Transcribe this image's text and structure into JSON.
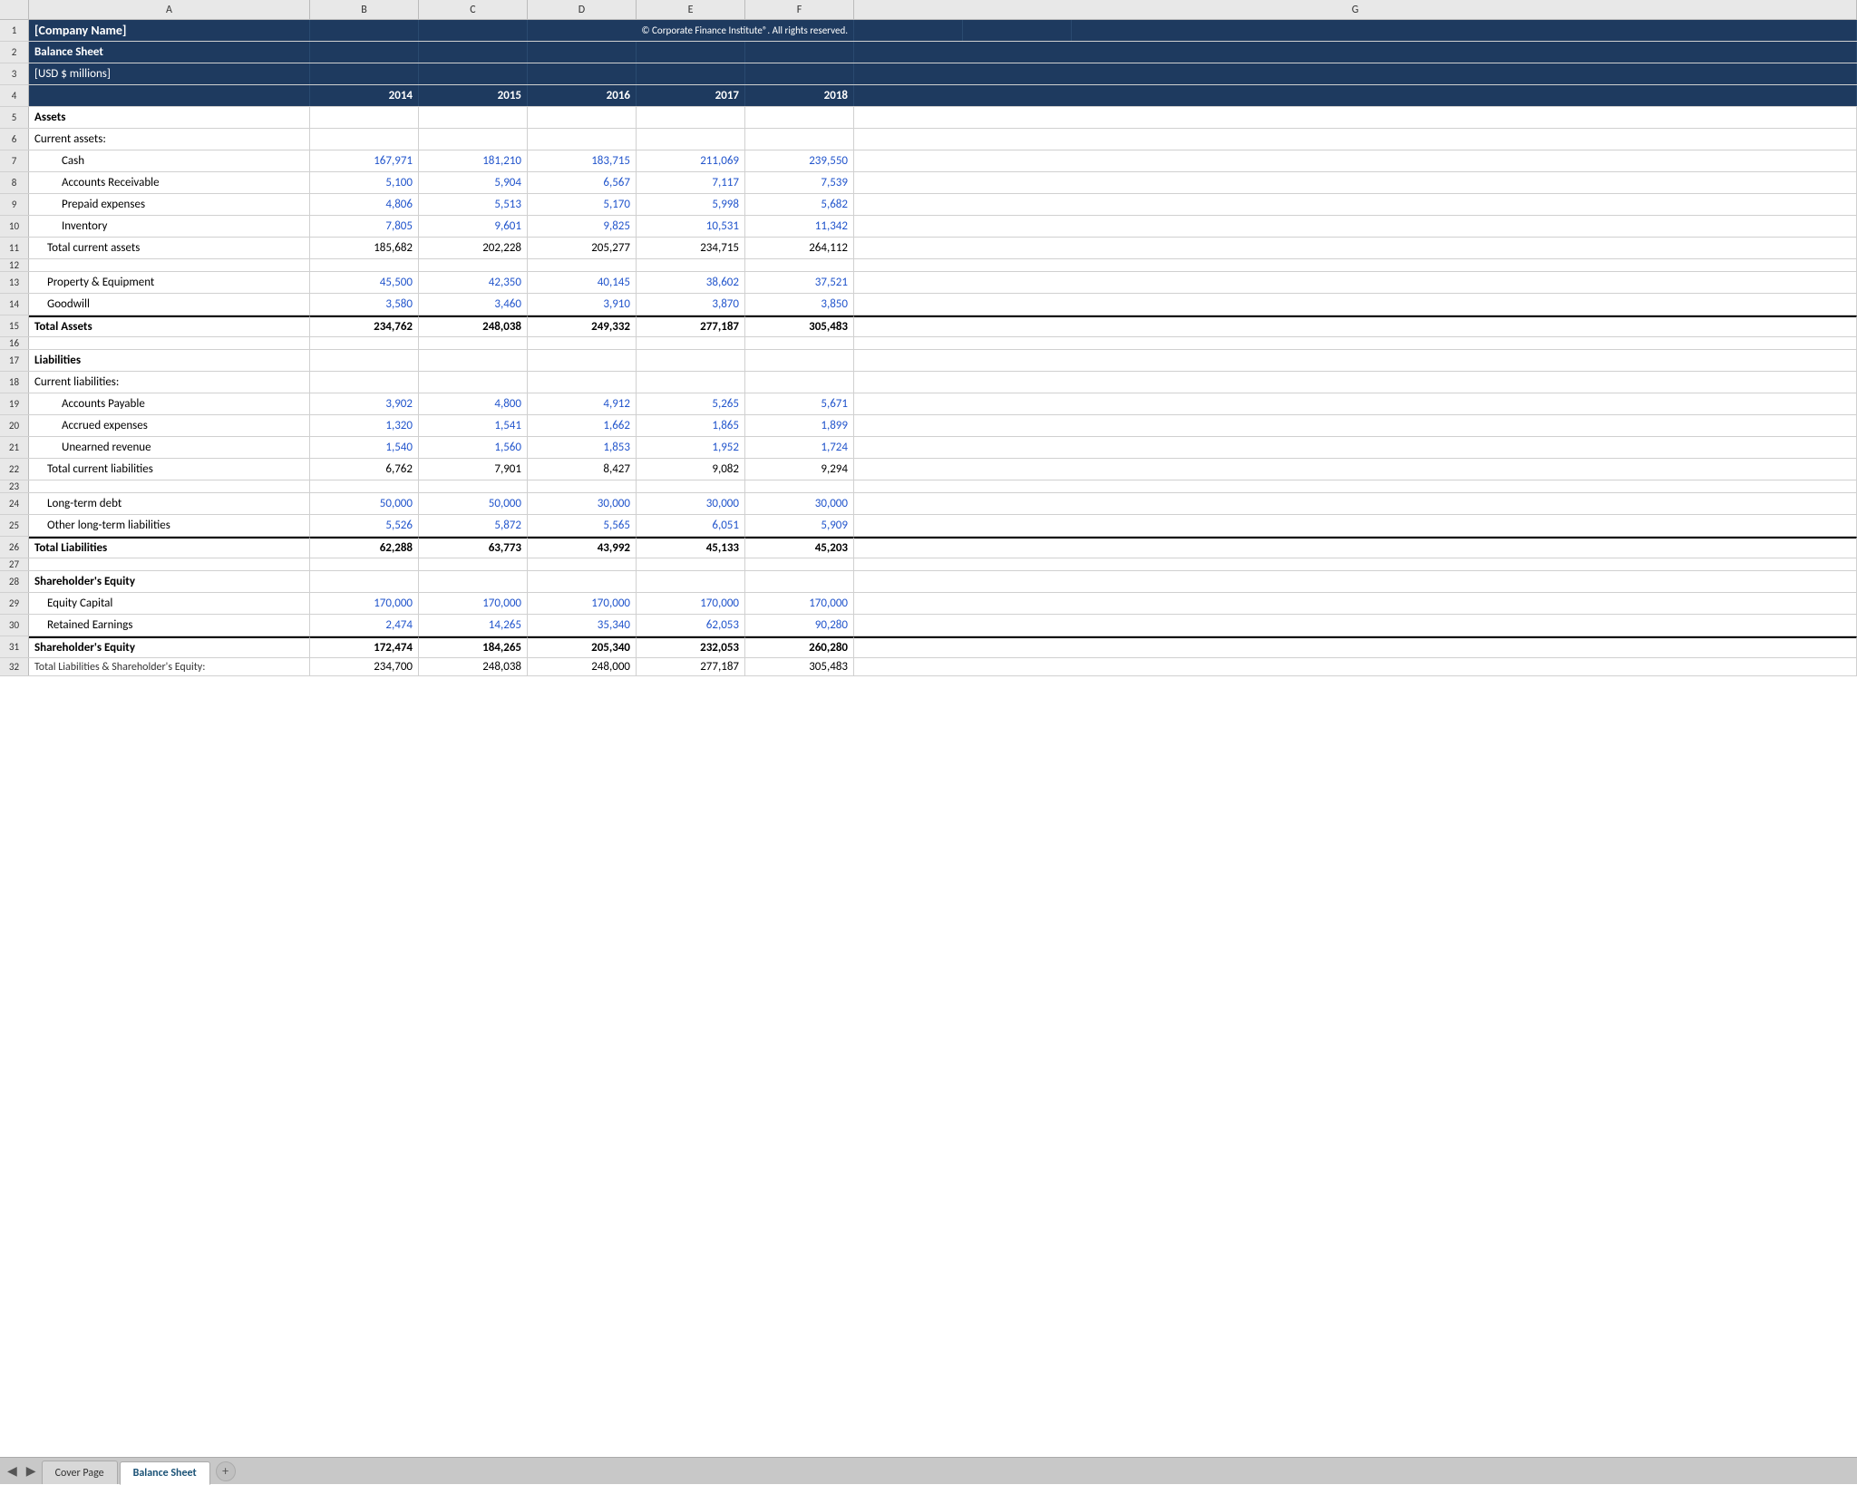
{
  "header": {
    "company_name": "[Company Name]",
    "title": "Balance Sheet",
    "currency": "[USD $ millions]",
    "copyright": "© Corporate Finance Institute®. All rights reserved."
  },
  "columns": {
    "headers": [
      "A",
      "B",
      "C",
      "D",
      "E",
      "F",
      "G"
    ],
    "years": [
      "2014",
      "2015",
      "2016",
      "2017",
      "2018"
    ]
  },
  "rows": [
    {
      "num": "1",
      "type": "dark-title",
      "label": "[Company Name]",
      "copyright": "© Corporate Finance Institute®. All rights reserved."
    },
    {
      "num": "2",
      "type": "dark",
      "label": "Balance Sheet"
    },
    {
      "num": "3",
      "type": "dark",
      "label": "[USD $ millions]"
    },
    {
      "num": "4",
      "type": "year-header",
      "values": [
        "2014",
        "2015",
        "2016",
        "2017",
        "2018"
      ]
    },
    {
      "num": "5",
      "type": "section",
      "label": "Assets"
    },
    {
      "num": "6",
      "type": "normal",
      "label": "Current assets:"
    },
    {
      "num": "7",
      "type": "data-blue",
      "label": "Cash",
      "indent": 2,
      "values": [
        "167,971",
        "181,210",
        "183,715",
        "211,069",
        "239,550"
      ]
    },
    {
      "num": "8",
      "type": "data-blue",
      "label": "Accounts Receivable",
      "indent": 2,
      "values": [
        "5,100",
        "5,904",
        "6,567",
        "7,117",
        "7,539"
      ]
    },
    {
      "num": "9",
      "type": "data-blue",
      "label": "Prepaid expenses",
      "indent": 2,
      "values": [
        "4,806",
        "5,513",
        "5,170",
        "5,998",
        "5,682"
      ]
    },
    {
      "num": "10",
      "type": "data-blue",
      "label": "Inventory",
      "indent": 2,
      "values": [
        "7,805",
        "9,601",
        "9,825",
        "10,531",
        "11,342"
      ]
    },
    {
      "num": "11",
      "type": "subtotal",
      "label": "Total current assets",
      "indent": 1,
      "values": [
        "185,682",
        "202,228",
        "205,277",
        "234,715",
        "264,112"
      ]
    },
    {
      "num": "12",
      "type": "spacer"
    },
    {
      "num": "13",
      "type": "data-blue",
      "label": "Property & Equipment",
      "indent": 1,
      "values": [
        "45,500",
        "42,350",
        "40,145",
        "38,602",
        "37,521"
      ]
    },
    {
      "num": "14",
      "type": "data-blue",
      "label": "Goodwill",
      "indent": 1,
      "values": [
        "3,580",
        "3,460",
        "3,910",
        "3,870",
        "3,850"
      ]
    },
    {
      "num": "15",
      "type": "total",
      "label": "Total Assets",
      "values": [
        "234,762",
        "248,038",
        "249,332",
        "277,187",
        "305,483"
      ]
    },
    {
      "num": "16",
      "type": "spacer"
    },
    {
      "num": "17",
      "type": "section",
      "label": "Liabilities"
    },
    {
      "num": "18",
      "type": "normal",
      "label": "Current liabilities:"
    },
    {
      "num": "19",
      "type": "data-blue",
      "label": "Accounts Payable",
      "indent": 2,
      "values": [
        "3,902",
        "4,800",
        "4,912",
        "5,265",
        "5,671"
      ]
    },
    {
      "num": "20",
      "type": "data-blue",
      "label": "Accrued expenses",
      "indent": 2,
      "values": [
        "1,320",
        "1,541",
        "1,662",
        "1,865",
        "1,899"
      ]
    },
    {
      "num": "21",
      "type": "data-blue",
      "label": "Unearned revenue",
      "indent": 2,
      "values": [
        "1,540",
        "1,560",
        "1,853",
        "1,952",
        "1,724"
      ]
    },
    {
      "num": "22",
      "type": "subtotal",
      "label": "Total current liabilities",
      "indent": 1,
      "values": [
        "6,762",
        "7,901",
        "8,427",
        "9,082",
        "9,294"
      ]
    },
    {
      "num": "23",
      "type": "spacer"
    },
    {
      "num": "24",
      "type": "data-blue",
      "label": "Long-term debt",
      "indent": 1,
      "values": [
        "50,000",
        "50,000",
        "30,000",
        "30,000",
        "30,000"
      ]
    },
    {
      "num": "25",
      "type": "data-blue",
      "label": "Other long-term liabilities",
      "indent": 1,
      "values": [
        "5,526",
        "5,872",
        "5,565",
        "6,051",
        "5,909"
      ]
    },
    {
      "num": "26",
      "type": "total",
      "label": "Total Liabilities",
      "values": [
        "62,288",
        "63,773",
        "43,992",
        "45,133",
        "45,203"
      ]
    },
    {
      "num": "27",
      "type": "spacer"
    },
    {
      "num": "28",
      "type": "section",
      "label": "Shareholder's Equity"
    },
    {
      "num": "29",
      "type": "data-blue",
      "label": "Equity Capital",
      "indent": 1,
      "values": [
        "170,000",
        "170,000",
        "170,000",
        "170,000",
        "170,000"
      ]
    },
    {
      "num": "30",
      "type": "data-blue",
      "label": "Retained Earnings",
      "indent": 1,
      "values": [
        "2,474",
        "14,265",
        "35,340",
        "62,053",
        "90,280"
      ]
    },
    {
      "num": "31",
      "type": "total",
      "label": "Shareholder's Equity",
      "values": [
        "172,474",
        "184,265",
        "205,340",
        "232,053",
        "260,280"
      ]
    },
    {
      "num": "32",
      "type": "subtotal-partial",
      "label": "Total Liabilities & Shareholder's Equity:",
      "values": [
        "234,700",
        "248,038",
        "248,000",
        "277,187",
        "305,483"
      ]
    }
  ],
  "tabs": {
    "items": [
      {
        "label": "Cover Page",
        "active": false
      },
      {
        "label": "Balance Sheet",
        "active": true
      }
    ],
    "add_label": "+"
  }
}
